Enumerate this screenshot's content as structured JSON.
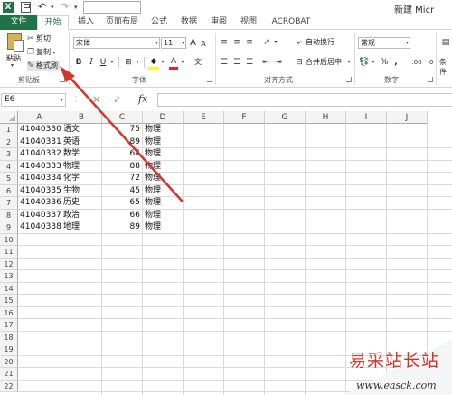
{
  "titlebar": {
    "app_icon": "X",
    "doc_title": "新建 Micr"
  },
  "tabs": [
    "文件",
    "开始",
    "插入",
    "页面布局",
    "公式",
    "数据",
    "审阅",
    "视图",
    "ACROBAT"
  ],
  "ribbon": {
    "clipboard": {
      "paste": "粘贴",
      "cut": "剪切",
      "copy": "复制",
      "format_painter": "格式刷",
      "group": "剪贴板"
    },
    "font": {
      "name": "宋体",
      "size": "11",
      "bold": "B",
      "italic": "I",
      "underline": "U",
      "grow": "A",
      "shrink": "A",
      "font_color": "A",
      "group": "字体"
    },
    "alignment": {
      "wrap": "自动换行",
      "merge": "合并后居中",
      "group": "对齐方式"
    },
    "number": {
      "format": "常规",
      "percent": "%",
      "comma": ",",
      "group": "数字"
    },
    "cutoff_label": "条件"
  },
  "formula_bar": {
    "cell_ref": "E6",
    "fx": "fx",
    "cancel": "✕",
    "enter": "✓",
    "value": ""
  },
  "sheet": {
    "columns": [
      "A",
      "B",
      "C",
      "D",
      "E",
      "F",
      "G",
      "H",
      "I",
      "J"
    ],
    "row_numbers": [
      "1",
      "2",
      "3",
      "4",
      "5",
      "6",
      "7",
      "8",
      "9",
      "10",
      "11",
      "12",
      "13",
      "14",
      "15",
      "16",
      "17",
      "18",
      "19",
      "20",
      "21",
      "22"
    ],
    "rows": [
      {
        "a": "41040330",
        "b": "语文",
        "c": "75",
        "d": "物理"
      },
      {
        "a": "41040331",
        "b": "英语",
        "c": "89",
        "d": "物理"
      },
      {
        "a": "41040332",
        "b": "数学",
        "c": "64",
        "d": "物理"
      },
      {
        "a": "41040333",
        "b": "物理",
        "c": "88",
        "d": "物理"
      },
      {
        "a": "41040334",
        "b": "化学",
        "c": "72",
        "d": "物理"
      },
      {
        "a": "41040335",
        "b": "生物",
        "c": "45",
        "d": "物理"
      },
      {
        "a": "41040336",
        "b": "历史",
        "c": "65",
        "d": "物理"
      },
      {
        "a": "41040337",
        "b": "政治",
        "c": "66",
        "d": "物理"
      },
      {
        "a": "41040338",
        "b": "地理",
        "c": "89",
        "d": "物理"
      }
    ]
  },
  "watermark": {
    "text": "易采站长站",
    "url": "www.easck.com"
  },
  "colors": {
    "excel_green": "#217346",
    "annotation_red": "#d4352b"
  }
}
